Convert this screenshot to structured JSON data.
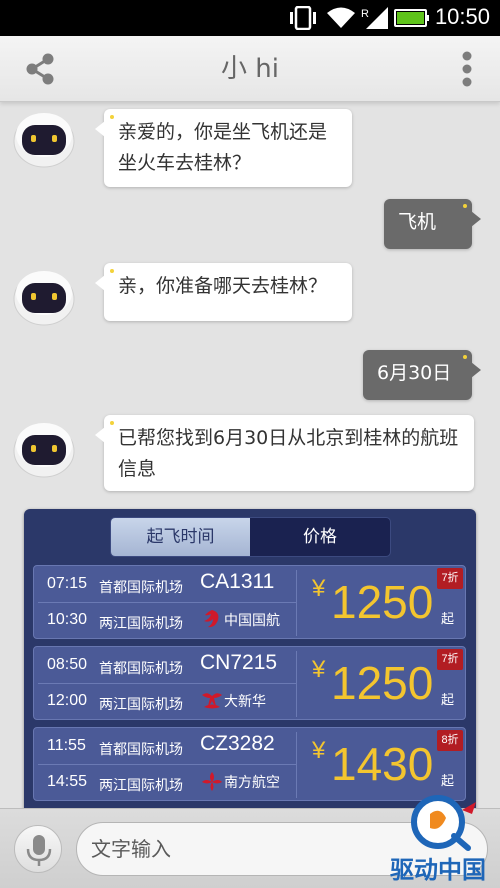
{
  "status_bar": {
    "time": "10:50",
    "icons": [
      "vibrate-icon",
      "wifi-icon",
      "signal-icon",
      "battery-icon"
    ]
  },
  "header": {
    "title": "小 hi",
    "share_icon": "share-icon",
    "menu_icon": "more-vert-icon"
  },
  "chat": {
    "messages": [
      {
        "from": "bot",
        "text": "亲爱的，你是坐飞机还是坐火车去桂林？"
      },
      {
        "from": "user",
        "text": "飞机"
      },
      {
        "from": "bot",
        "text": "亲，你准备哪天去桂林？"
      },
      {
        "from": "user",
        "text": "6月30日"
      },
      {
        "from": "bot",
        "text": "已帮您找到6月30日从北京到桂林的航班信息"
      }
    ]
  },
  "flights": {
    "tabs": [
      {
        "label": "起飞时间",
        "active": true
      },
      {
        "label": "价格",
        "active": false
      }
    ],
    "items": [
      {
        "dep_time": "07:15",
        "dep_airport": "首都国际机场",
        "arr_time": "10:30",
        "arr_airport": "两江国际机场",
        "flight_no": "CA1311",
        "airline": "中国国航",
        "currency": "¥",
        "price": "1250",
        "price_suffix": "起",
        "discount": "7折"
      },
      {
        "dep_time": "08:50",
        "dep_airport": "首都国际机场",
        "arr_time": "12:00",
        "arr_airport": "两江国际机场",
        "flight_no": "CN7215",
        "airline": "大新华",
        "currency": "¥",
        "price": "1250",
        "price_suffix": "起",
        "discount": "7折"
      },
      {
        "dep_time": "11:55",
        "dep_airport": "首都国际机场",
        "arr_time": "14:55",
        "arr_airport": "两江国际机场",
        "flight_no": "CZ3282",
        "airline": "南方航空",
        "currency": "¥",
        "price": "1430",
        "price_suffix": "起",
        "discount": "8折"
      }
    ]
  },
  "input": {
    "placeholder": "文字输入",
    "mic_icon": "mic-icon"
  },
  "watermark": {
    "text": "驱动中国"
  },
  "colors": {
    "panel": "#2b3869",
    "card": "#4b5a97",
    "price": "#f3c52f",
    "discount": "#b21d23"
  }
}
